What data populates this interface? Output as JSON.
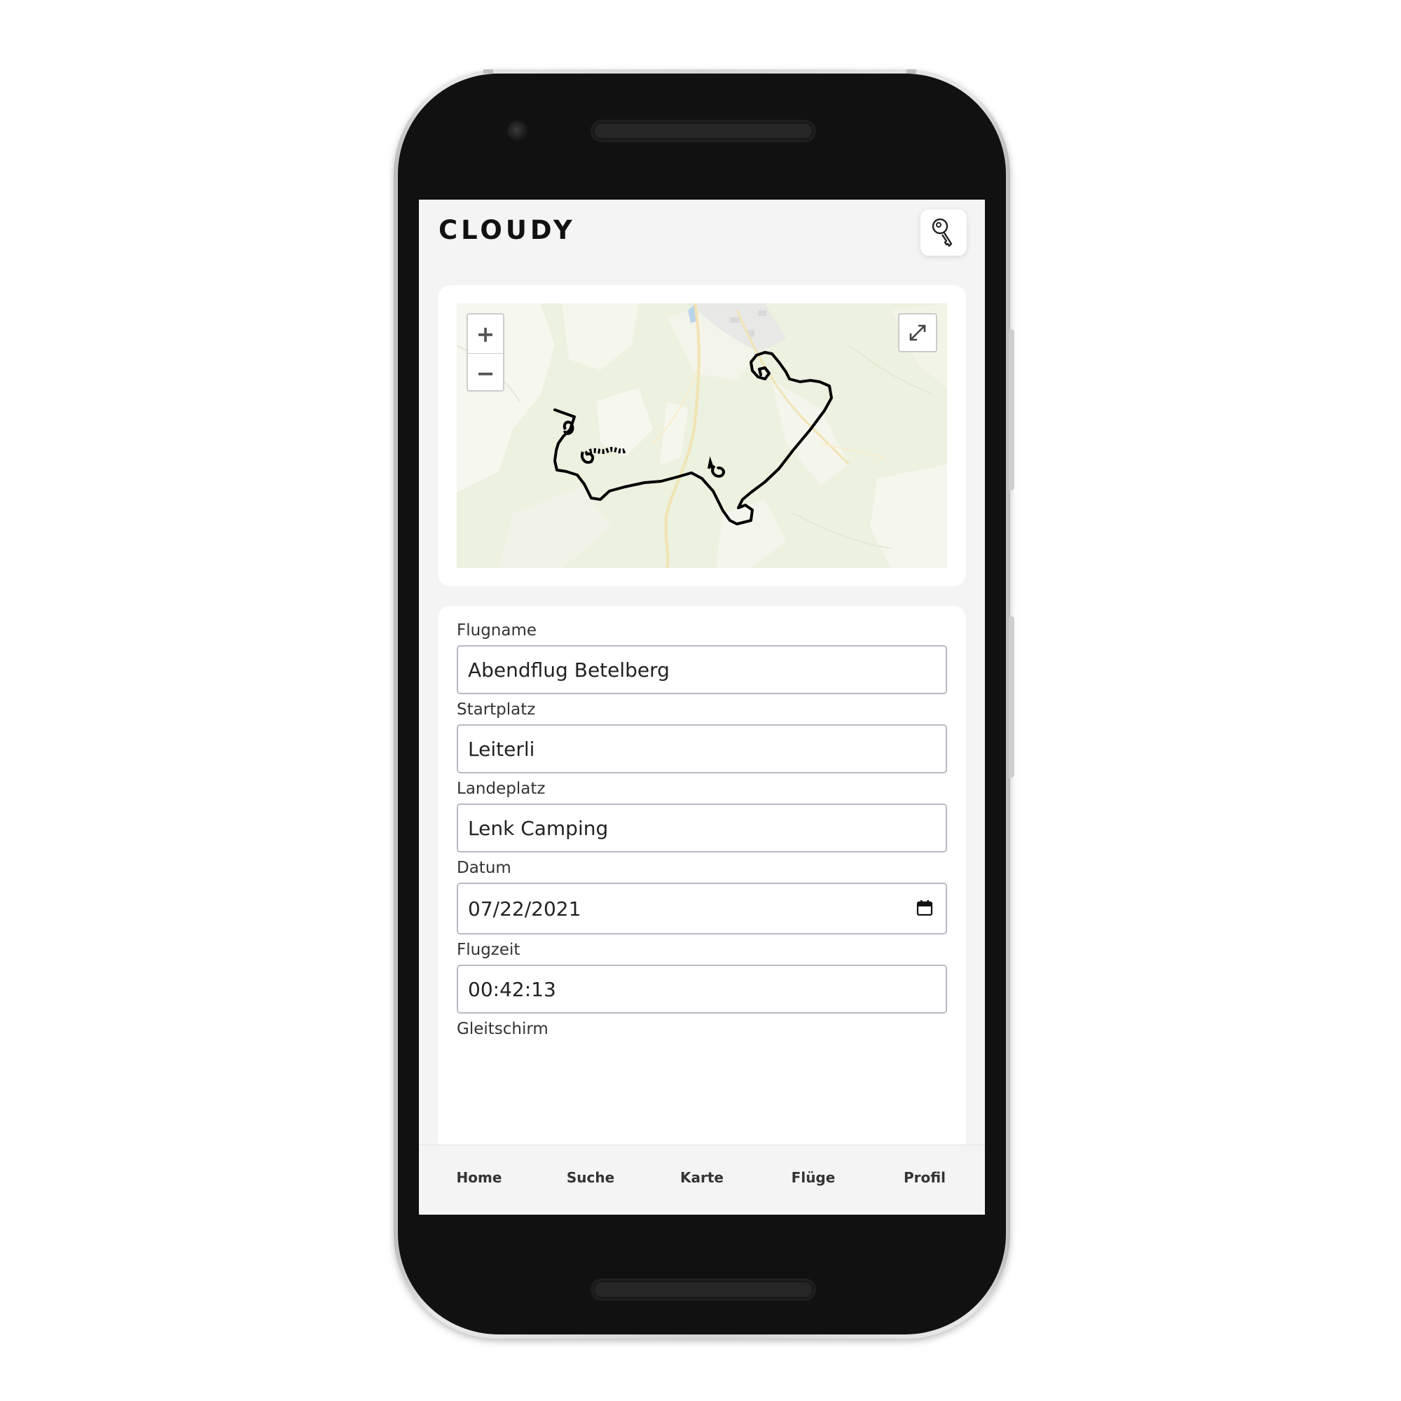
{
  "app": {
    "title": "CLOUDY"
  },
  "icons": {
    "header_action": "key-icon",
    "zoom_in": "plus-icon",
    "zoom_out": "minus-icon",
    "fullscreen": "expand-icon",
    "date_picker": "calendar-icon"
  },
  "map": {
    "zoom_in_label": "+",
    "zoom_out_label": "−",
    "track_color": "#000000"
  },
  "form": {
    "flugname": {
      "label": "Flugname",
      "value": "Abendflug Betelberg"
    },
    "startplatz": {
      "label": "Startplatz",
      "value": "Leiterli"
    },
    "landeplatz": {
      "label": "Landeplatz",
      "value": "Lenk Camping"
    },
    "datum": {
      "label": "Datum",
      "value": "07/22/2021"
    },
    "flugzeit": {
      "label": "Flugzeit",
      "value": "00:42:13"
    },
    "gleitschirm": {
      "label": "Gleitschirm"
    }
  },
  "nav": {
    "items": [
      {
        "label": "Home"
      },
      {
        "label": "Suche"
      },
      {
        "label": "Karte"
      },
      {
        "label": "Flüge"
      },
      {
        "label": "Profil"
      }
    ]
  }
}
